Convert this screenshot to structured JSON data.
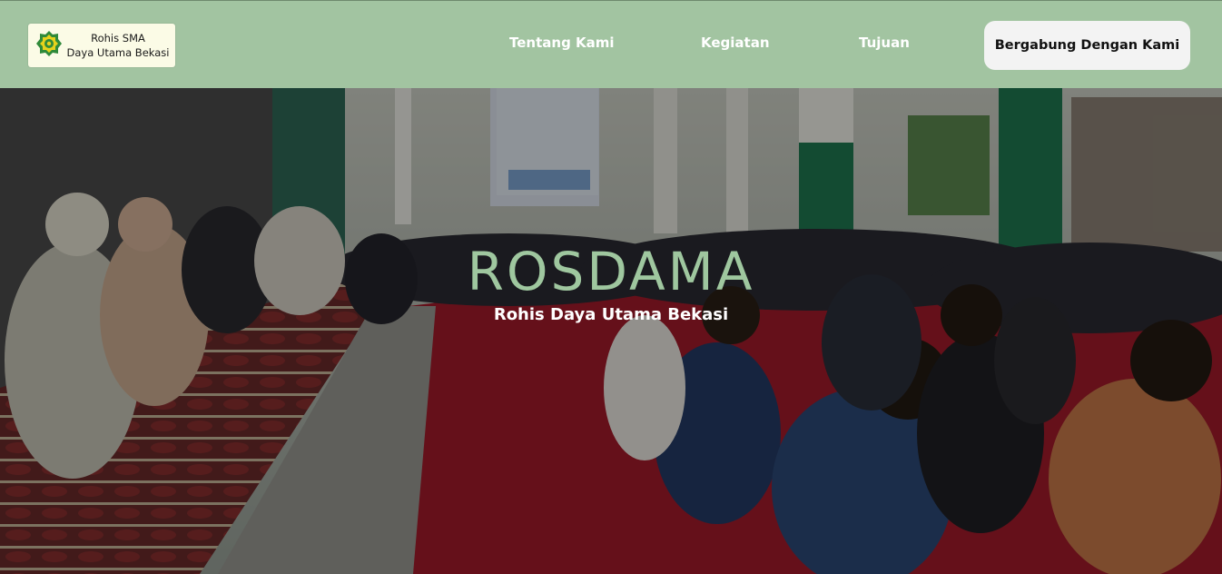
{
  "header": {
    "logo": {
      "line1": "Rohis SMA",
      "line2": "Daya Utama Bekasi",
      "icon": "mosque-emblem-icon"
    },
    "nav": {
      "about": "Tentang Kami",
      "activities": "Kegiatan",
      "goals": "Tujuan"
    },
    "cta_label": "Bergabung Dengan Kami"
  },
  "hero": {
    "title": "ROSDAMA",
    "subtitle": "Rohis Daya Utama Bekasi",
    "image": "photo of students seated on red carpets in a mosque hall"
  },
  "colors": {
    "navbar_bg": "#a2c4a1",
    "title_green": "#9fc79f",
    "cta_bg": "#f3f3f3",
    "logo_bg": "#fbfbe6",
    "carpet_red": "#a31b2a"
  }
}
